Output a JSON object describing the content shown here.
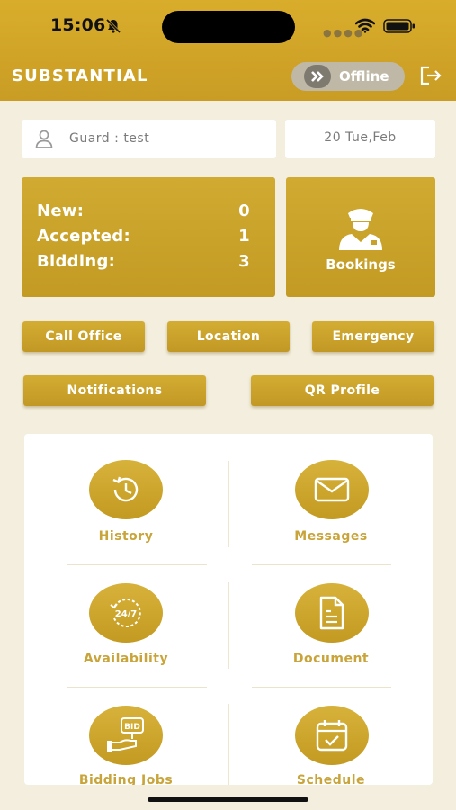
{
  "status_bar": {
    "time": "15:06"
  },
  "header": {
    "title": "SUBSTANTIAL",
    "status_toggle_label": "Offline"
  },
  "guard": {
    "label": "Guard : test",
    "date": "20 Tue,Feb"
  },
  "stats": {
    "rows": [
      {
        "label": "New:",
        "value": "0"
      },
      {
        "label": "Accepted:",
        "value": "1"
      },
      {
        "label": "Bidding:",
        "value": "3"
      }
    ]
  },
  "bookings": {
    "label": "Bookings",
    "icon": "security-guard-icon"
  },
  "actions": {
    "call_office": "Call Office",
    "location": "Location",
    "emergency": "Emergency",
    "notifications": "Notifications",
    "qr_profile": "QR Profile"
  },
  "menu": {
    "tiles": [
      {
        "label": "History",
        "icon": "history-icon"
      },
      {
        "label": "Messages",
        "icon": "envelope-icon"
      },
      {
        "label": "Availability",
        "icon": "24-7-icon"
      },
      {
        "label": "Document",
        "icon": "document-icon"
      },
      {
        "label": "Bidding Jobs",
        "icon": "bid-icon"
      },
      {
        "label": "Schedule",
        "icon": "calendar-icon"
      }
    ]
  },
  "colors": {
    "gold": "#c9a22a",
    "background": "#f3eedd",
    "tile_label": "#c9a43a",
    "toggle_bg": "#bfb8a6"
  }
}
